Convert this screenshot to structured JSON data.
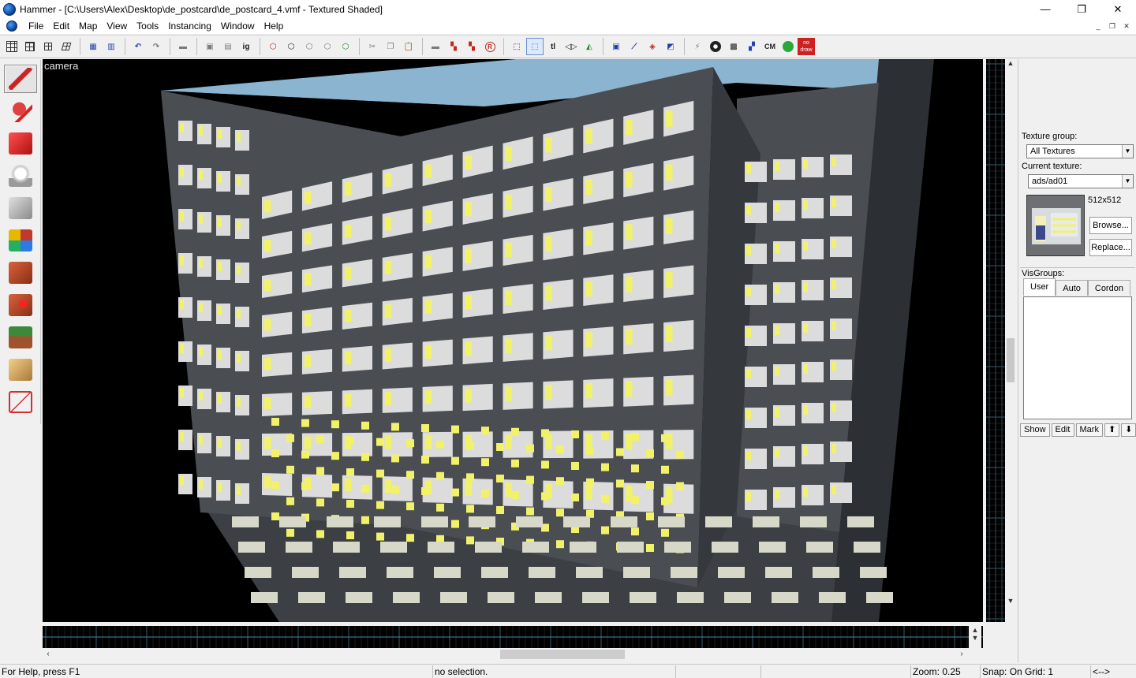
{
  "window": {
    "title": "Hammer - [C:\\Users\\Alex\\Desktop\\de_postcard\\de_postcard_4.vmf - Textured Shaded]",
    "controls": {
      "minimize": "—",
      "maximize": "❐",
      "close": "✕"
    }
  },
  "menu": {
    "items": [
      "File",
      "Edit",
      "Map",
      "View",
      "Tools",
      "Instancing",
      "Window",
      "Help"
    ],
    "mdi_controls": {
      "minimize": "_",
      "restore": "❐",
      "close": "✕"
    }
  },
  "toolbar": {
    "labels": {
      "ig": "ig",
      "tl": "tl",
      "cm": "CM",
      "nodraw": "no draw",
      "r_circle": "R"
    }
  },
  "viewport": {
    "label": "camera",
    "sky_color": "#8ab4d0",
    "wall_color": "#4a4d52",
    "ad_color": "#dcdcdc",
    "ad_accent": "#f2f26a"
  },
  "texture_panel": {
    "group_label": "Texture group:",
    "group_value": "All Textures",
    "current_label": "Current texture:",
    "current_value": "ads/ad01",
    "size": "512x512",
    "browse_button": "Browse...",
    "replace_button": "Replace..."
  },
  "visgroups": {
    "label": "VisGroups:",
    "tabs": [
      "User",
      "Auto",
      "Cordon"
    ],
    "buttons": {
      "show": "Show",
      "edit": "Edit",
      "mark": "Mark",
      "up": "⬆",
      "down": "⬇"
    }
  },
  "status": {
    "help": "For Help, press F1",
    "selection": "no selection.",
    "zoom": "Zoom: 0.25",
    "snap": "Snap: On Grid: 1",
    "arrows": "<-->"
  }
}
